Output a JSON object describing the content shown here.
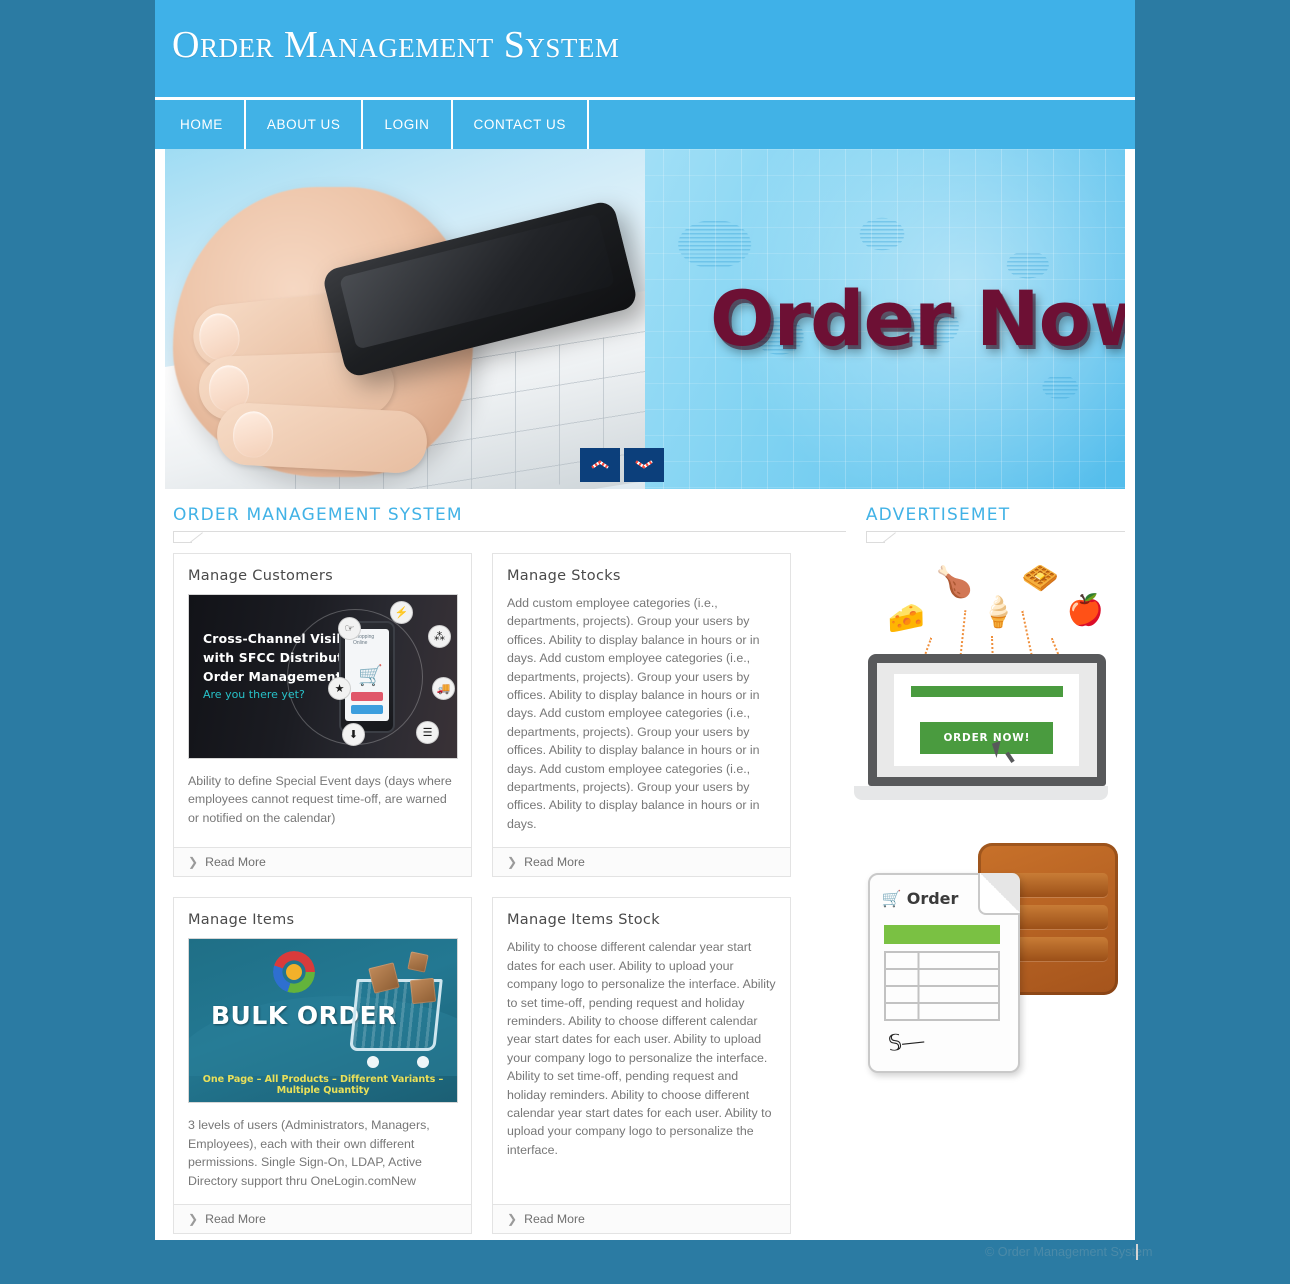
{
  "header": {
    "site_title": "Order Management System"
  },
  "nav": {
    "items": [
      {
        "label": "HOME"
      },
      {
        "label": "ABOUT US"
      },
      {
        "label": "LOGIN"
      },
      {
        "label": "CONTACT US"
      }
    ]
  },
  "banner": {
    "headline": "Order Now",
    "prev_icon": "chevron-up-icon",
    "next_icon": "chevron-down-icon"
  },
  "main": {
    "section_title": "ORDER MANAGEMENT SYSTEM",
    "cards": [
      {
        "title": "Manage Customers",
        "thumb": {
          "line1": "Cross-Channel Visibility",
          "line2": "with SFCC Distributed",
          "line3": "Order Management",
          "sub": "Are you there yet?",
          "screen_label": "Shopping Online"
        },
        "text": "Ability to define Special Event days (days where employees cannot request time-off, are warned or notified on the calendar)",
        "read_more": "Read More"
      },
      {
        "title": "Manage Stocks",
        "text": "Add custom employee categories (i.e., departments, projects). Group your users by offices. Ability to display balance in hours or in days. Add custom employee categories (i.e., departments, projects). Group your users by offices. Ability to display balance in hours or in days. Add custom employee categories (i.e., departments, projects). Group your users by offices. Ability to display balance in hours or in days. Add custom employee categories (i.e., departments, projects). Group your users by offices. Ability to display balance in hours or in days.",
        "read_more": "Read More"
      },
      {
        "title": "Manage Items",
        "thumb": {
          "title": "BULK ORDER",
          "footer": "One Page – All Products – Different  Variants – Multiple Quantity"
        },
        "text": "3 levels of users (Administrators, Managers, Employees), each with their own different permissions. Single Sign-On, LDAP, Active Directory support thru OneLogin.comNew",
        "read_more": "Read More"
      },
      {
        "title": "Manage Items Stock",
        "text": "Ability to choose different calendar year start dates for each user. Ability to upload your company logo to personalize the interface. Ability to set time-off, pending request and holiday reminders. Ability to choose different calendar year start dates for each user. Ability to upload your company logo to personalize the interface. Ability to set time-off, pending request and holiday reminders. Ability to choose different calendar year start dates for each user. Ability to upload your company logo to personalize the interface.",
        "read_more": "Read More"
      }
    ]
  },
  "sidebar": {
    "section_title": "ADVERTISEMET",
    "ad1": {
      "button_label": "ORDER NOW!",
      "icons": [
        "cheese-icon",
        "roast-chicken-icon",
        "ice-cream-icon",
        "waffle-icon",
        "apple-icon"
      ],
      "cursor_icon": "mouse-cursor-icon"
    },
    "ad2": {
      "doc_title": "Order",
      "cart_icon": "shopping-cart-icon",
      "crate_icon": "wooden-crate-icon",
      "signature_icon": "signature-icon"
    }
  },
  "footer": {
    "copyright": "© Order Management System"
  },
  "colors": {
    "page_bg": "#2b7ba3",
    "header_bg": "#3fb1e8",
    "accent": "#41b2e6",
    "heading_text": "#4a4a4a",
    "body_text": "#777777",
    "banner_headline": "#6d1034",
    "ad_green": "#4a9b3f",
    "ad_orange": "#ef8f3c"
  }
}
